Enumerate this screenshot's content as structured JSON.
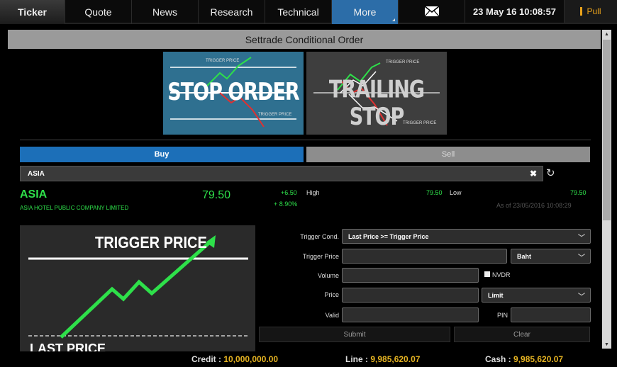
{
  "nav": {
    "tabs": [
      "Ticker",
      "Quote",
      "News",
      "Research",
      "Technical",
      "More"
    ],
    "datetime": "23 May 16  10:08:57",
    "pull_label": "Pull"
  },
  "title": "Settrade Conditional Order",
  "order_types": {
    "stop": {
      "label": "STOP ORDER",
      "top_caption": "TRIGGER PRICE",
      "bottom_caption": "TRIGGER PRICE"
    },
    "trailing": {
      "label": "TRAILING STOP",
      "top_caption": "TRIGGER PRICE",
      "bottom_caption": "TRIGGER PRICE"
    }
  },
  "side": {
    "buy": "Buy",
    "sell": "Sell"
  },
  "search": {
    "value": "ASIA"
  },
  "quote": {
    "symbol": "ASIA",
    "name": "ASIA HOTEL PUBLIC COMPANY LIMITED",
    "last": "79.50",
    "change": "+6.50",
    "percent": "+ 8.90%",
    "high_label": "High",
    "high": "79.50",
    "low_label": "Low",
    "low": "79.50",
    "as_of": "As of 23/05/2016 10:08:29"
  },
  "illustration": {
    "trigger": "TRIGGER PRICE",
    "last": "LAST PRICE"
  },
  "form": {
    "trigger_cond_label": "Trigger Cond.",
    "trigger_cond_value": "Last Price >= Trigger Price",
    "trigger_price_label": "Trigger Price",
    "trigger_price_value": "",
    "unit_value": "Baht",
    "volume_label": "Volume",
    "volume_value": "",
    "nvdr_label": "NVDR",
    "price_label": "Price",
    "price_value": "",
    "price_type": "Limit",
    "valid_label": "Valid",
    "valid_value": "",
    "pin_label": "PIN",
    "pin_value": "",
    "submit": "Submit",
    "clear": "Clear"
  },
  "footer": {
    "credit_label": "Credit : ",
    "credit_value": "10,000,000.00",
    "line_label": "Line : ",
    "line_value": "9,985,620.07",
    "cash_label": "Cash : ",
    "cash_value": "9,985,620.07"
  },
  "colors": {
    "up": "#2ee04a",
    "accent": "#1c6fb8",
    "balance": "#e6b422"
  }
}
